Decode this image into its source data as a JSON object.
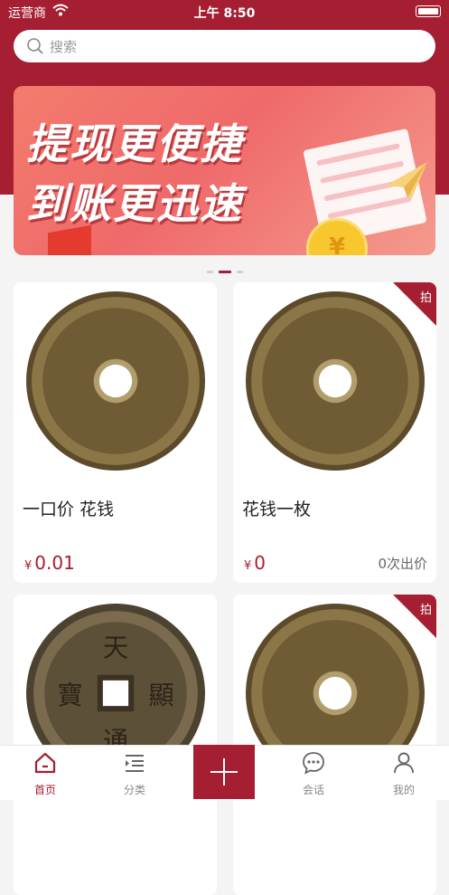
{
  "status": {
    "carrier": "运营商",
    "time": "上午 8:50"
  },
  "search": {
    "placeholder": "搜索"
  },
  "banner": {
    "line1": "提现更便捷",
    "line2": "到账更迅速",
    "coin_symbol": "¥"
  },
  "carousel": {
    "count": 3,
    "active": 2
  },
  "products": [
    {
      "title": "一口价 花钱",
      "currency": "¥",
      "price": "0.01",
      "bids": "",
      "tag": ""
    },
    {
      "title": "花钱一枚",
      "currency": "¥",
      "price": "0",
      "bids": "0次出价",
      "tag": "拍"
    },
    {
      "title": "",
      "currency": "",
      "price": "",
      "bids": "",
      "tag": ""
    },
    {
      "title": "",
      "currency": "",
      "price": "",
      "bids": "",
      "tag": "拍"
    }
  ],
  "coin_glyphs": {
    "square_hole": [
      "天",
      "顯",
      "通",
      "寶"
    ]
  },
  "tabbar": {
    "home": "首页",
    "category": "分类",
    "chat": "会话",
    "mine": "我的"
  },
  "colors": {
    "brand": "#a51e31",
    "background": "#f4f4f4"
  }
}
